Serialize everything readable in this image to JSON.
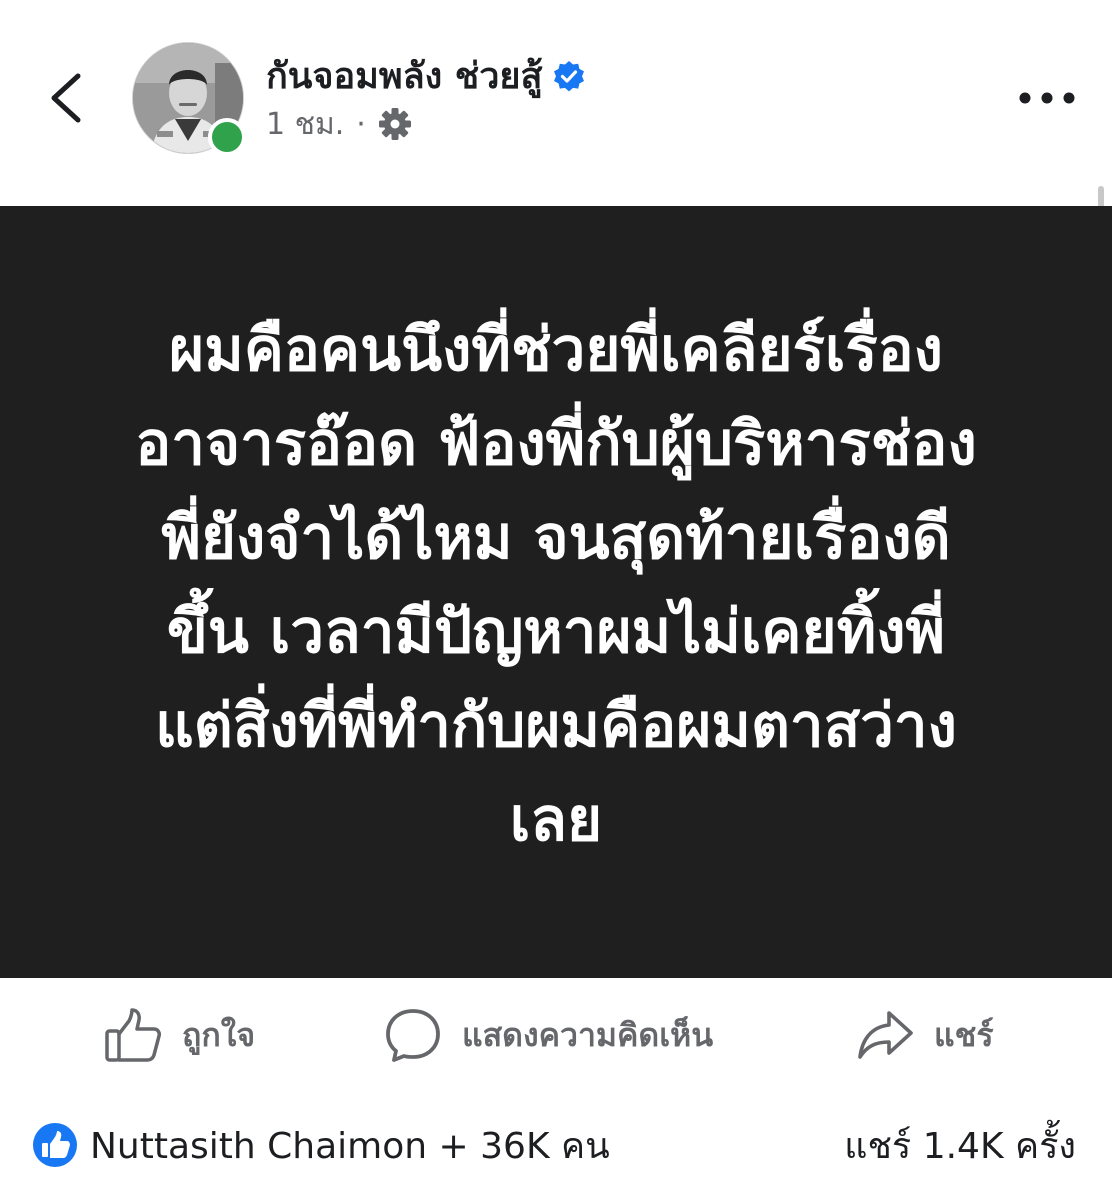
{
  "header": {
    "page_name": "กันจอมพลัง ช่วยสู้",
    "time_ago": "1 ชม.",
    "meta_separator": "·",
    "verified": true,
    "online": true
  },
  "post": {
    "text": "ผมคือคนนึงที่ช่วยพี่เคลียร์เรื่อง\nอาจารอ๊อด ฟ้องพี่กับผู้บริหารช่อง\nพี่ยังจำได้ไหม จนสุดท้ายเรื่องดี\nขึ้น เวลามีปัญหาผมไม่เคยทิ้งพี่\nแต่สิ่งที่พี่ทำกับผมคือผมตาสว่าง\nเลย",
    "background_color": "#1f1f1f",
    "text_color": "#ffffff"
  },
  "actions": {
    "like_label": "ถูกใจ",
    "comment_label": "แสดงความคิดเห็น",
    "share_label": "แชร์"
  },
  "summary": {
    "reactors_text": "Nuttasith Chaimon + 36K คน",
    "shares_text": "แชร์ 1.4K ครั้ง"
  },
  "colors": {
    "accent_blue": "#1877f2",
    "online_green": "#31a24c",
    "secondary_text": "#65676b"
  },
  "icons": {
    "back": "chevron-left-icon",
    "verified": "verified-badge-icon",
    "privacy": "gear-icon",
    "more": "more-dots-icon",
    "like": "thumbs-up-icon",
    "comment": "comment-bubble-icon",
    "share": "share-arrow-icon",
    "like_reaction": "like-reaction-icon"
  }
}
